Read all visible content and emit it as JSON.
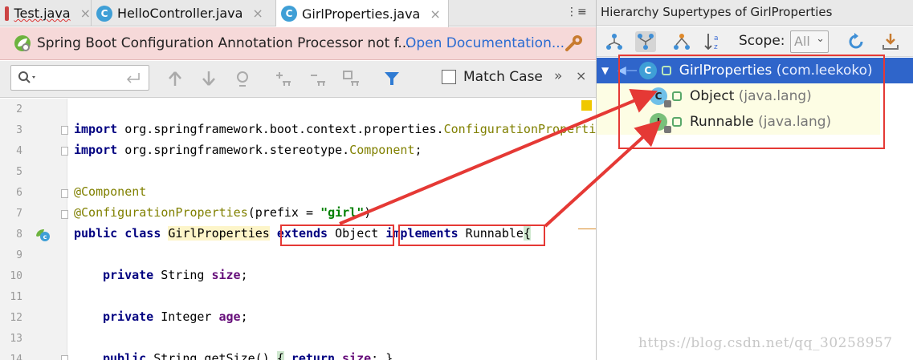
{
  "tabs": [
    {
      "label": "Test.java",
      "close": "×"
    },
    {
      "label": "HelloController.java",
      "close": "×"
    },
    {
      "label": "GirlProperties.java",
      "close": "×"
    }
  ],
  "tab_menu": "⋮≡",
  "notice": {
    "text": "Spring Boot Configuration Annotation Processor not f...",
    "link": "Open Documentation..."
  },
  "findbar": {
    "search_placeholder": "",
    "match_case_label": "Match Case",
    "more": "»",
    "close": "×"
  },
  "line_numbers": [
    "2",
    "3",
    "4",
    "5",
    "6",
    "7",
    "8",
    "9",
    "10",
    "11",
    "12",
    "13",
    "14"
  ],
  "code": {
    "l3_kw": "import",
    "l3_pkg": " org.springframework.boot.context.properties.",
    "l3_cls": "ConfigurationPropertie",
    "l4_kw": "import",
    "l4_pkg": " org.springframework.stereotype.",
    "l4_cls": "Component",
    "l4_end": ";",
    "l6": "@Component",
    "l7_ann": "@ConfigurationProperties",
    "l7_a": "(prefix = ",
    "l7_str": "\"girl\"",
    "l7_b": ")",
    "l8_kw": "public class",
    "l8_cls": "GirlProperties",
    "l8_ext": "extends",
    "l8_obj": " Object",
    "l8_impl": "implements",
    "l8_run": " Runnable",
    "l8_brace": "{",
    "l10_kw": "private",
    "l10_type": " String ",
    "l10_fld": "size",
    "l10_end": ";",
    "l12_kw": "private",
    "l12_type": " Integer ",
    "l12_fld": "age",
    "l12_end": ";",
    "l14_kw": "public",
    "l14_rest": " String getSize() ",
    "l14_b1": "{",
    "l14_ret": " return ",
    "l14_fld": "size",
    "l14_end": "; }"
  },
  "hierarchy": {
    "title": "Hierarchy Supertypes of GirlProperties",
    "scope_label": "Scope:",
    "scope_value": "All",
    "nodes": [
      {
        "badge": "C",
        "name": "GirlProperties",
        "pkg": "(com.leekoko)",
        "badge_color": "#3f9fd6"
      },
      {
        "badge": "C",
        "name": "Object",
        "pkg": "(java.lang)",
        "badge_color": "#6fc0e8"
      },
      {
        "badge": "I",
        "name": "Runnable",
        "pkg": "(java.lang)",
        "badge_color": "#79c07b"
      }
    ]
  },
  "watermark": "https://blog.csdn.net/qq_30258957",
  "colors": {
    "annotation_red": "#e53935",
    "selection_blue": "#2f65ca",
    "keyword": "#000080",
    "string": "#008000",
    "field": "#660e7a",
    "annotation": "#808000"
  },
  "icons": {
    "tab_class": "class-c-icon",
    "notice": "spring-leaf-icon",
    "notice_settings": "wrench-gear-icon",
    "search": "magnifier-icon",
    "filter": "funnel-icon",
    "hier_super": "supertypes-icon",
    "hier_sub": "subtypes-icon",
    "hier_type": "type-hierarchy-icon",
    "sort": "sort-alpha-icon",
    "refresh": "refresh-icon",
    "export": "export-icon"
  }
}
